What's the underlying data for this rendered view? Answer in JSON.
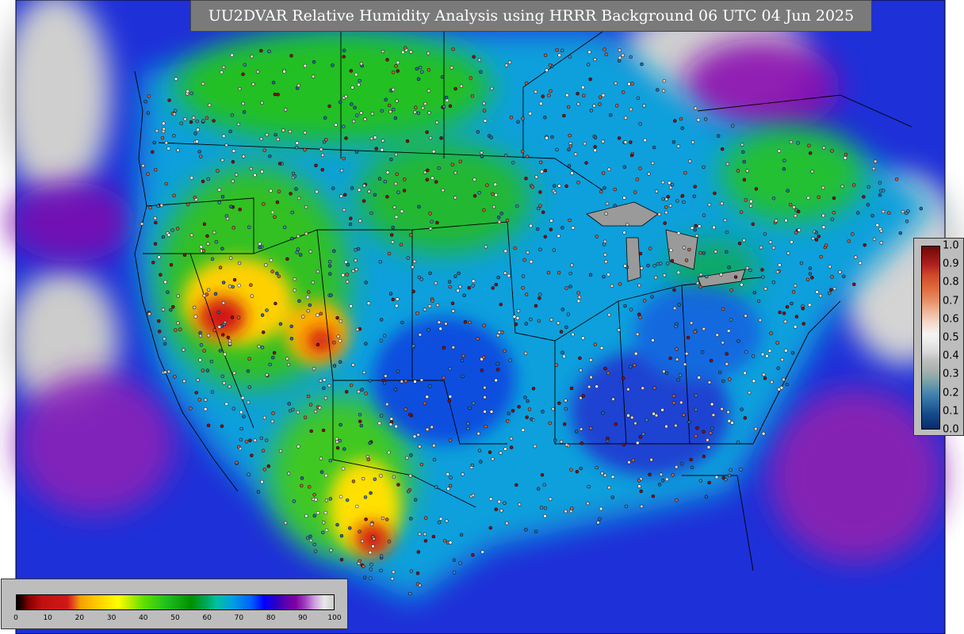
{
  "title": "UU2DVAR Relative Humidity Analysis using HRRR Background 06 UTC 04 Jun 2025",
  "rh_colorbar": {
    "ticks": [
      "0",
      "10",
      "20",
      "30",
      "40",
      "50",
      "60",
      "70",
      "80",
      "90",
      "100"
    ]
  },
  "increment_colorbar": {
    "ticks": [
      "0.0",
      "0.1",
      "0.2",
      "0.3",
      "0.4",
      "0.5",
      "0.6",
      "0.7",
      "0.8",
      "0.9",
      "1.0"
    ]
  },
  "colors": {
    "ocean_humid": "#1a2acc",
    "dry_red": "#d01818",
    "mid_green": "#20c020",
    "moist_blue": "#00a0e0",
    "saturated_purple": "#8000a0",
    "panel_gray": "#bdbdbd",
    "title_gray": "#7a7a7a"
  }
}
